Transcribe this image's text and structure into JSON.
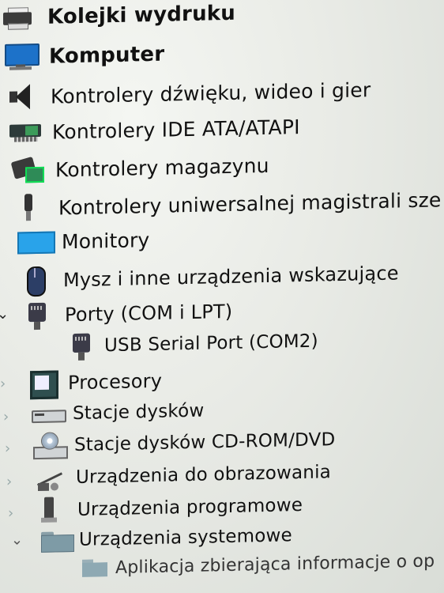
{
  "device_tree": {
    "items": [
      {
        "label": "Kolejki wydruku",
        "icon": "printer-icon",
        "expanded": false
      },
      {
        "label": "Komputer",
        "icon": "monitor-icon",
        "expanded": false
      },
      {
        "label": "Kontrolery dźwięku, wideo i gier",
        "icon": "speaker-icon",
        "expanded": false
      },
      {
        "label": "Kontrolery IDE ATA/ATAPI",
        "icon": "ide-controller-icon",
        "expanded": false
      },
      {
        "label": "Kontrolery magazynu",
        "icon": "storage-controller-icon",
        "expanded": false
      },
      {
        "label": "Kontrolery uniwersalnej magistrali sze",
        "icon": "usb-plug-icon",
        "expanded": false
      },
      {
        "label": "Monitory",
        "icon": "display-icon",
        "expanded": false
      },
      {
        "label": "Mysz i inne urządzenia wskazujące",
        "icon": "mouse-icon",
        "expanded": false
      },
      {
        "label": "Porty (COM i LPT)",
        "icon": "port-icon",
        "expanded": true
      },
      {
        "label": "USB Serial Port (COM2)",
        "icon": "serial-port-icon",
        "child": true
      },
      {
        "label": "Procesory",
        "icon": "cpu-icon",
        "expanded": false
      },
      {
        "label": "Stacje dysków",
        "icon": "disk-drive-icon",
        "expanded": false
      },
      {
        "label": "Stacje dysków CD-ROM/DVD",
        "icon": "cd-drive-icon",
        "expanded": false
      },
      {
        "label": "Urządzenia do obrazowania",
        "icon": "camera-icon",
        "expanded": false
      },
      {
        "label": "Urządzenia programowe",
        "icon": "software-device-icon",
        "expanded": false
      },
      {
        "label": "Urządzenia systemowe",
        "icon": "folder-icon",
        "expanded": true
      },
      {
        "label": "Aplikacja zbierająca informacje o op",
        "icon": "folder-icon",
        "child": true
      }
    ]
  },
  "colors": {
    "text": "#111111",
    "chevron": "#99aaaa",
    "background": "#e9ebe6"
  }
}
